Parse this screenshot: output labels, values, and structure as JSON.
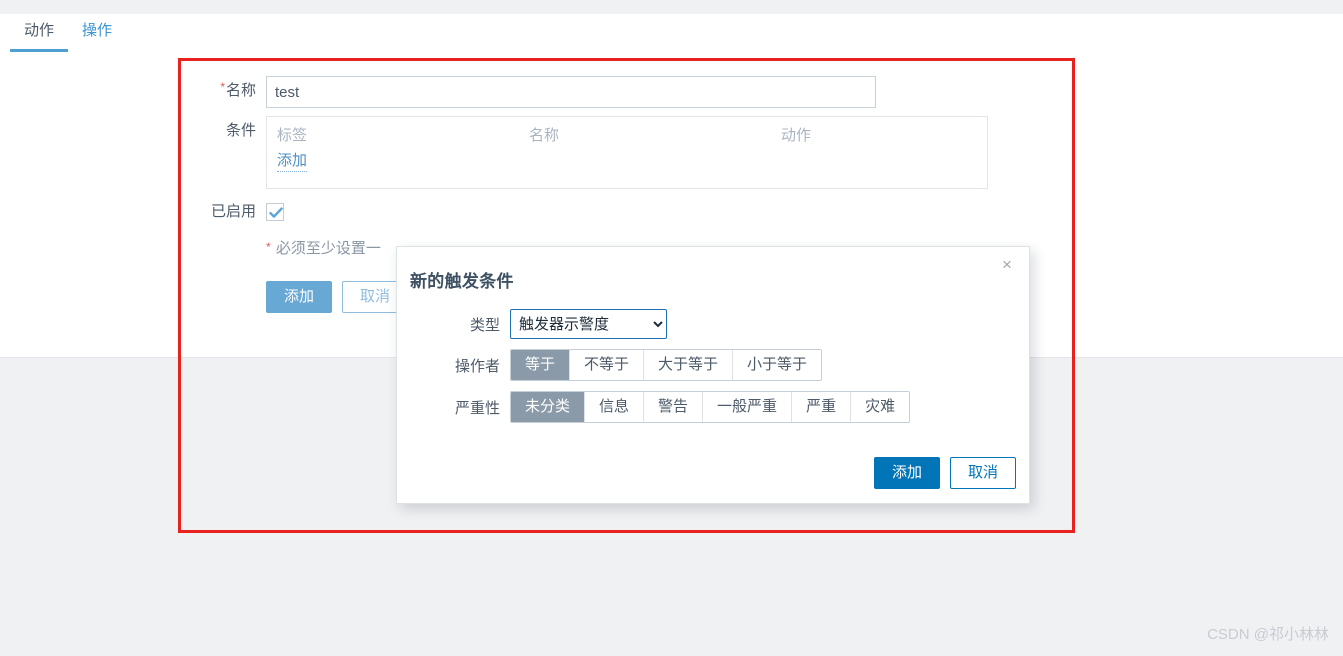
{
  "tabs": [
    {
      "label": "动作",
      "active": true
    },
    {
      "label": "操作",
      "active": false
    }
  ],
  "form": {
    "name": {
      "label": "名称",
      "required_marker": "*",
      "value": "test",
      "placeholder": ""
    },
    "conditions": {
      "label": "条件",
      "columns": [
        "标签",
        "名称",
        "动作"
      ],
      "rows": [],
      "add_link": "添加"
    },
    "enabled": {
      "label": "已启用",
      "checked": true
    },
    "hint": {
      "required_marker": "*",
      "text": "必须至少设置一"
    },
    "buttons": {
      "submit": "添加",
      "cancel": "取消"
    }
  },
  "dialog": {
    "title": "新的触发条件",
    "close_icon": "×",
    "type": {
      "label": "类型",
      "selected": "触发器示警度",
      "options": [
        "触发器示警度"
      ]
    },
    "operator": {
      "label": "操作者",
      "options": [
        "等于",
        "不等于",
        "大于等于",
        "小于等于"
      ],
      "selected": "等于"
    },
    "severity": {
      "label": "严重性",
      "options": [
        "未分类",
        "信息",
        "警告",
        "一般严重",
        "严重",
        "灾难"
      ],
      "selected": "未分类"
    },
    "buttons": {
      "submit": "添加",
      "cancel": "取消"
    }
  },
  "watermark": "CSDN @祁小林林",
  "colors": {
    "highlight_border": "#e8221f",
    "tab_active_underline": "#4e9fd3",
    "primary_button": "#0275b8",
    "segment_selected": "#8a9aa8",
    "required_star": "#e45959"
  }
}
